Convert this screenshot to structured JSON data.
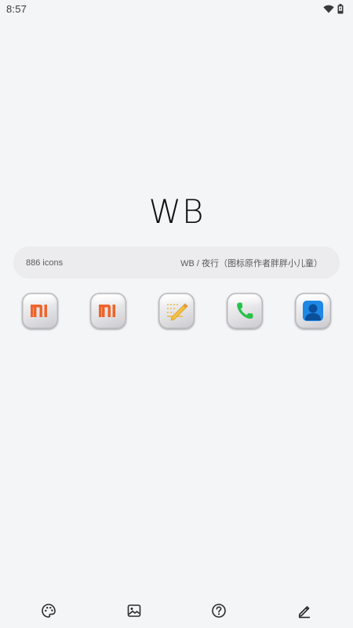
{
  "status_bar": {
    "time": "8:57",
    "icons": [
      "wifi-icon",
      "battery-icon"
    ]
  },
  "pack": {
    "title": "WB",
    "icon_count": "886 icons",
    "author": "WB / 夜行（图标原作者胖胖小儿童）"
  },
  "preview_icons": [
    {
      "name": "mi-icon",
      "color": "#f0642b"
    },
    {
      "name": "mi-icon",
      "color": "#f0642b"
    },
    {
      "name": "notes-icon",
      "color": "#f2b53c"
    },
    {
      "name": "phone-icon",
      "color": "#28c24a"
    },
    {
      "name": "contacts-icon",
      "color": "#1e88e5"
    }
  ],
  "bottom_nav": [
    {
      "name": "palette-icon"
    },
    {
      "name": "wallpaper-icon"
    },
    {
      "name": "help-icon"
    },
    {
      "name": "edit-icon"
    }
  ],
  "colors": {
    "background": "#f4f5f7",
    "info_bar": "#ececee",
    "text_dark": "#111111",
    "text_muted": "#5a5a5a"
  }
}
